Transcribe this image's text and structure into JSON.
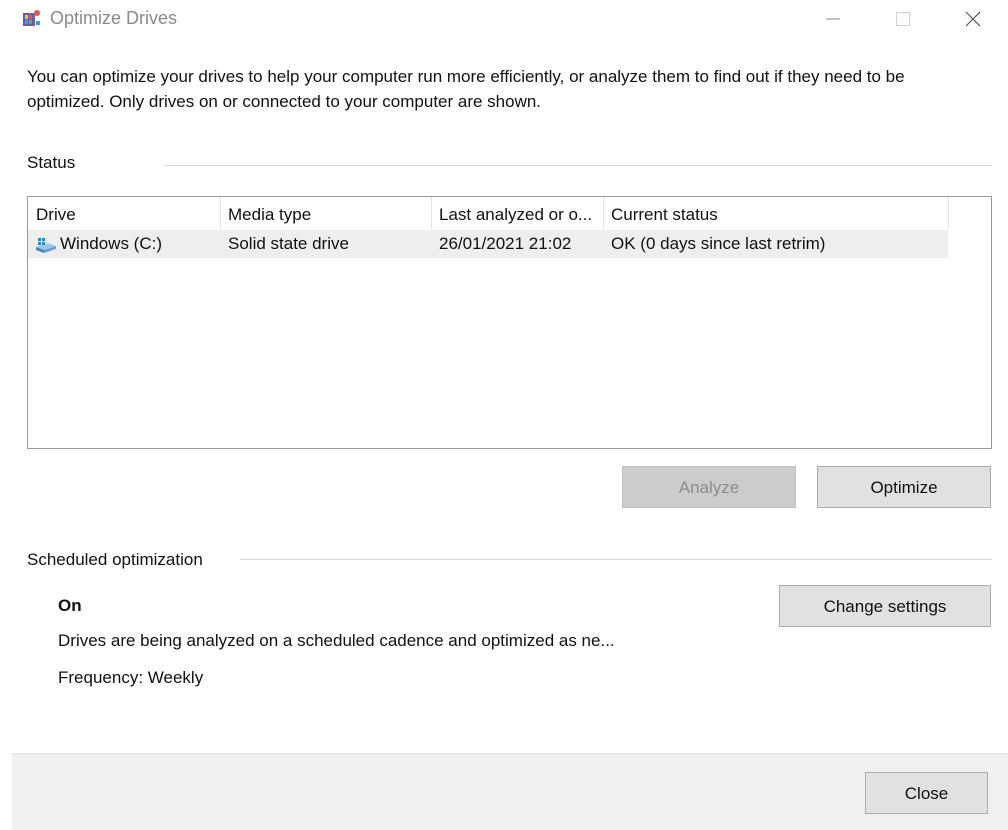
{
  "window": {
    "title": "Optimize Drives",
    "app_icon": "optimize-drives-icon",
    "controls": {
      "minimize": "minimize-icon",
      "maximize": "maximize-icon",
      "close": "close-icon"
    }
  },
  "intro_text": "You can optimize your drives to help your computer run more efficiently, or analyze them to find out if they need to be optimized. Only drives on or connected to your computer are shown.",
  "status": {
    "label": "Status",
    "columns": [
      "Drive",
      "Media type",
      "Last analyzed or o...",
      "Current status"
    ],
    "rows": [
      {
        "drive": "Windows (C:)",
        "media_type": "Solid state drive",
        "last_analyzed": "26/01/2021 21:02",
        "current_status": "OK (0 days since last retrim)",
        "icon": "drive-icon"
      }
    ]
  },
  "buttons": {
    "analyze": "Analyze",
    "optimize": "Optimize",
    "change_settings": "Change settings",
    "close": "Close"
  },
  "scheduled": {
    "label": "Scheduled optimization",
    "state": "On",
    "description": "Drives are being analyzed on a scheduled cadence and optimized as ne...",
    "frequency": "Frequency: Weekly"
  }
}
